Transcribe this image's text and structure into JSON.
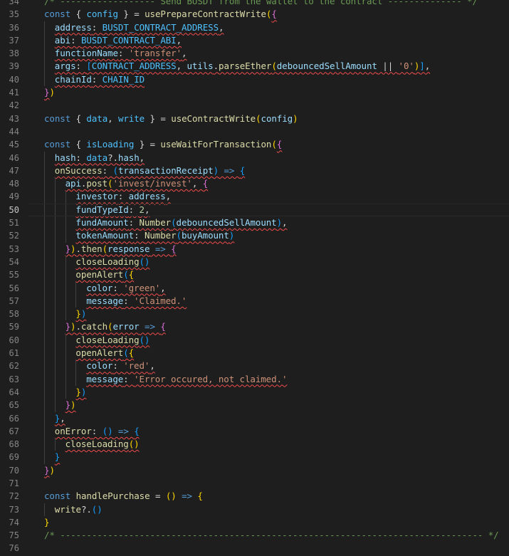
{
  "editor": {
    "language": "javascript",
    "current_line": 50,
    "colors": {
      "background": "#1e1e1e",
      "comment": "#6a9955",
      "keyword": "#569cd6",
      "function": "#dcdcaa",
      "string": "#ce9178",
      "number": "#b5cea8",
      "variable": "#9cdcfe",
      "constant": "#4fc1ff",
      "error_squiggle": "#f14c4c"
    },
    "lines": [
      {
        "n": "34",
        "indent": 1,
        "tokens": [
          {
            "t": "/* ------------------ Send BUSDT from the wallet to the contract -------------- */",
            "c": "cmt"
          }
        ]
      },
      {
        "n": "35",
        "indent": 1,
        "tokens": [
          {
            "t": "const",
            "c": "kw"
          },
          {
            "t": " { ",
            "c": "punct"
          },
          {
            "t": "config",
            "c": "const"
          },
          {
            "t": " } = ",
            "c": "punct"
          },
          {
            "t": "usePrepareContractWrite",
            "c": "fn"
          },
          {
            "t": "(",
            "c": "br1"
          },
          {
            "t": "{",
            "c": "br2",
            "s": true
          }
        ]
      },
      {
        "n": "36",
        "indent": 2,
        "tokens": [
          {
            "t": "address",
            "c": "plain",
            "s": true
          },
          {
            "t": ": ",
            "c": "punct",
            "s": true
          },
          {
            "t": "BUSDT_CONTRACT_ADDRESS",
            "c": "const",
            "s": true
          },
          {
            "t": ",",
            "c": "punct",
            "s": true
          }
        ]
      },
      {
        "n": "37",
        "indent": 2,
        "tokens": [
          {
            "t": "abi",
            "c": "plain",
            "s": true
          },
          {
            "t": ": ",
            "c": "punct",
            "s": true
          },
          {
            "t": "BUSDT_CONTRACT_ABI",
            "c": "const",
            "s": true
          },
          {
            "t": ",",
            "c": "punct",
            "s": true
          }
        ]
      },
      {
        "n": "38",
        "indent": 2,
        "tokens": [
          {
            "t": "functionName",
            "c": "plain",
            "s": true
          },
          {
            "t": ": ",
            "c": "punct",
            "s": true
          },
          {
            "t": "'transfer'",
            "c": "str",
            "s": true
          },
          {
            "t": ",",
            "c": "punct",
            "s": true
          }
        ]
      },
      {
        "n": "39",
        "indent": 2,
        "tokens": [
          {
            "t": "args",
            "c": "plain",
            "s": true
          },
          {
            "t": ": ",
            "c": "punct",
            "s": true
          },
          {
            "t": "[",
            "c": "br3",
            "s": true
          },
          {
            "t": "CONTRACT_ADDRESS",
            "c": "const",
            "s": true
          },
          {
            "t": ", ",
            "c": "punct",
            "s": true
          },
          {
            "t": "utils",
            "c": "plain",
            "s": true
          },
          {
            "t": ".",
            "c": "punct",
            "s": true
          },
          {
            "t": "parseEther",
            "c": "fn",
            "s": true
          },
          {
            "t": "(",
            "c": "br1",
            "s": true
          },
          {
            "t": "debouncedSellAmount",
            "c": "plain",
            "s": true
          },
          {
            "t": " || ",
            "c": "punct",
            "s": true
          },
          {
            "t": "'0'",
            "c": "str",
            "s": true
          },
          {
            "t": ")",
            "c": "br1",
            "s": true
          },
          {
            "t": "]",
            "c": "br3",
            "s": true
          },
          {
            "t": ",",
            "c": "punct",
            "s": true
          }
        ]
      },
      {
        "n": "40",
        "indent": 2,
        "tokens": [
          {
            "t": "chainId",
            "c": "plain",
            "s": true
          },
          {
            "t": ": ",
            "c": "punct",
            "s": true
          },
          {
            "t": "CHAIN_ID",
            "c": "const",
            "s": true
          }
        ]
      },
      {
        "n": "41",
        "indent": 1,
        "tokens": [
          {
            "t": "}",
            "c": "br2",
            "s": true
          },
          {
            "t": ")",
            "c": "br1"
          }
        ]
      },
      {
        "n": "42",
        "indent": 0,
        "tokens": []
      },
      {
        "n": "43",
        "indent": 1,
        "tokens": [
          {
            "t": "const",
            "c": "kw"
          },
          {
            "t": " { ",
            "c": "punct"
          },
          {
            "t": "data",
            "c": "const"
          },
          {
            "t": ", ",
            "c": "punct"
          },
          {
            "t": "write",
            "c": "const"
          },
          {
            "t": " } = ",
            "c": "punct"
          },
          {
            "t": "useContractWrite",
            "c": "fn"
          },
          {
            "t": "(",
            "c": "br1"
          },
          {
            "t": "config",
            "c": "plain"
          },
          {
            "t": ")",
            "c": "br1"
          }
        ]
      },
      {
        "n": "44",
        "indent": 0,
        "tokens": []
      },
      {
        "n": "45",
        "indent": 1,
        "tokens": [
          {
            "t": "const",
            "c": "kw"
          },
          {
            "t": " { ",
            "c": "punct"
          },
          {
            "t": "isLoading",
            "c": "const"
          },
          {
            "t": " } = ",
            "c": "punct"
          },
          {
            "t": "useWaitForTransaction",
            "c": "fn"
          },
          {
            "t": "(",
            "c": "br1"
          },
          {
            "t": "{",
            "c": "br2",
            "s": true
          }
        ]
      },
      {
        "n": "46",
        "indent": 2,
        "tokens": [
          {
            "t": "hash",
            "c": "plain",
            "s": true
          },
          {
            "t": ": ",
            "c": "punct",
            "s": true
          },
          {
            "t": "data",
            "c": "const",
            "s": true
          },
          {
            "t": "?.",
            "c": "punct",
            "s": true
          },
          {
            "t": "hash",
            "c": "plain",
            "s": true
          },
          {
            "t": ",",
            "c": "punct",
            "s": true
          }
        ]
      },
      {
        "n": "47",
        "indent": 2,
        "tokens": [
          {
            "t": "onSuccess",
            "c": "fn",
            "s": true
          },
          {
            "t": ": ",
            "c": "punct",
            "s": true
          },
          {
            "t": "(",
            "c": "br3",
            "s": true
          },
          {
            "t": "transactionReceipt",
            "c": "param",
            "s": true
          },
          {
            "t": ")",
            "c": "br3",
            "s": true
          },
          {
            "t": " => ",
            "c": "kw",
            "s": true
          },
          {
            "t": "{",
            "c": "br3",
            "s": true
          }
        ]
      },
      {
        "n": "48",
        "indent": 3,
        "tokens": [
          {
            "t": "api",
            "c": "plain",
            "s": true
          },
          {
            "t": ".",
            "c": "punct",
            "s": true
          },
          {
            "t": "post",
            "c": "fn",
            "s": true
          },
          {
            "t": "(",
            "c": "br1",
            "s": true
          },
          {
            "t": "'invest/invest'",
            "c": "str",
            "s": true
          },
          {
            "t": ", ",
            "c": "punct",
            "s": true
          },
          {
            "t": "{",
            "c": "br2",
            "s": true
          }
        ]
      },
      {
        "n": "49",
        "indent": 4,
        "tokens": [
          {
            "t": "investor",
            "c": "plain",
            "s": true
          },
          {
            "t": ": ",
            "c": "punct",
            "s": true
          },
          {
            "t": "address",
            "c": "plain",
            "s": true
          },
          {
            "t": ",",
            "c": "punct",
            "s": true
          }
        ]
      },
      {
        "n": "50",
        "indent": 4,
        "tokens": [
          {
            "t": "fundTypeId",
            "c": "plain",
            "s": true
          },
          {
            "t": ": ",
            "c": "punct",
            "s": true
          },
          {
            "t": "2",
            "c": "num",
            "s": true
          },
          {
            "t": ",",
            "c": "punct",
            "s": true
          }
        ]
      },
      {
        "n": "51",
        "indent": 4,
        "tokens": [
          {
            "t": "fundAmount",
            "c": "plain",
            "s": true
          },
          {
            "t": ": ",
            "c": "punct",
            "s": true
          },
          {
            "t": "Number",
            "c": "fn",
            "s": true
          },
          {
            "t": "(",
            "c": "br3",
            "s": true
          },
          {
            "t": "debouncedSellAmount",
            "c": "plain",
            "s": true
          },
          {
            "t": ")",
            "c": "br3",
            "s": true
          },
          {
            "t": ",",
            "c": "punct",
            "s": true
          }
        ]
      },
      {
        "n": "52",
        "indent": 4,
        "tokens": [
          {
            "t": "tokenAmount",
            "c": "plain",
            "s": true
          },
          {
            "t": ": ",
            "c": "punct",
            "s": true
          },
          {
            "t": "Number",
            "c": "fn",
            "s": true
          },
          {
            "t": "(",
            "c": "br3",
            "s": true
          },
          {
            "t": "buyAmount",
            "c": "plain",
            "s": true
          },
          {
            "t": ")",
            "c": "br3",
            "s": true
          }
        ]
      },
      {
        "n": "53",
        "indent": 3,
        "tokens": [
          {
            "t": "}",
            "c": "br2",
            "s": true
          },
          {
            "t": ")",
            "c": "br1",
            "s": true
          },
          {
            "t": ".",
            "c": "punct",
            "s": true
          },
          {
            "t": "then",
            "c": "fn",
            "s": true
          },
          {
            "t": "(",
            "c": "br1",
            "s": true
          },
          {
            "t": "response",
            "c": "param",
            "s": true
          },
          {
            "t": " => ",
            "c": "kw",
            "s": true
          },
          {
            "t": "{",
            "c": "br2",
            "s": true
          }
        ]
      },
      {
        "n": "54",
        "indent": 4,
        "tokens": [
          {
            "t": "closeLoading",
            "c": "fn",
            "s": true
          },
          {
            "t": "()",
            "c": "br3",
            "s": true
          }
        ]
      },
      {
        "n": "55",
        "indent": 4,
        "tokens": [
          {
            "t": "openAlert",
            "c": "fn",
            "s": true
          },
          {
            "t": "(",
            "c": "br3",
            "s": true
          },
          {
            "t": "{",
            "c": "br1",
            "s": true
          }
        ]
      },
      {
        "n": "56",
        "indent": 5,
        "tokens": [
          {
            "t": "color",
            "c": "plain",
            "s": true
          },
          {
            "t": ": ",
            "c": "punct",
            "s": true
          },
          {
            "t": "'green'",
            "c": "str",
            "s": true
          },
          {
            "t": ",",
            "c": "punct",
            "s": true
          }
        ]
      },
      {
        "n": "57",
        "indent": 5,
        "tokens": [
          {
            "t": "message",
            "c": "plain",
            "s": true
          },
          {
            "t": ": ",
            "c": "punct",
            "s": true
          },
          {
            "t": "'Claimed.'",
            "c": "str",
            "s": true
          }
        ]
      },
      {
        "n": "58",
        "indent": 4,
        "tokens": [
          {
            "t": "}",
            "c": "br1",
            "s": true
          },
          {
            "t": ")",
            "c": "br3",
            "s": true
          }
        ]
      },
      {
        "n": "59",
        "indent": 3,
        "tokens": [
          {
            "t": "}",
            "c": "br2",
            "s": true
          },
          {
            "t": ")",
            "c": "br1",
            "s": true
          },
          {
            "t": ".",
            "c": "punct",
            "s": true
          },
          {
            "t": "catch",
            "c": "fn",
            "s": true
          },
          {
            "t": "(",
            "c": "br1",
            "s": true
          },
          {
            "t": "error",
            "c": "param",
            "s": true
          },
          {
            "t": " => ",
            "c": "kw",
            "s": true
          },
          {
            "t": "{",
            "c": "br2",
            "s": true
          }
        ]
      },
      {
        "n": "60",
        "indent": 4,
        "tokens": [
          {
            "t": "closeLoading",
            "c": "fn",
            "s": true
          },
          {
            "t": "()",
            "c": "br3",
            "s": true
          }
        ]
      },
      {
        "n": "61",
        "indent": 4,
        "tokens": [
          {
            "t": "openAlert",
            "c": "fn",
            "s": true
          },
          {
            "t": "(",
            "c": "br3",
            "s": true
          },
          {
            "t": "{",
            "c": "br1",
            "s": true
          }
        ]
      },
      {
        "n": "62",
        "indent": 5,
        "tokens": [
          {
            "t": "color",
            "c": "plain",
            "s": true
          },
          {
            "t": ": ",
            "c": "punct",
            "s": true
          },
          {
            "t": "'red'",
            "c": "str",
            "s": true
          },
          {
            "t": ",",
            "c": "punct",
            "s": true
          }
        ]
      },
      {
        "n": "63",
        "indent": 5,
        "tokens": [
          {
            "t": "message",
            "c": "plain",
            "s": true
          },
          {
            "t": ": ",
            "c": "punct",
            "s": true
          },
          {
            "t": "'Error occured, not claimed.'",
            "c": "str",
            "s": true
          }
        ]
      },
      {
        "n": "64",
        "indent": 4,
        "tokens": [
          {
            "t": "}",
            "c": "br1",
            "s": true
          },
          {
            "t": ")",
            "c": "br3",
            "s": true
          }
        ]
      },
      {
        "n": "65",
        "indent": 3,
        "tokens": [
          {
            "t": "}",
            "c": "br2",
            "s": true
          },
          {
            "t": ")",
            "c": "br1",
            "s": true
          }
        ]
      },
      {
        "n": "66",
        "indent": 2,
        "tokens": [
          {
            "t": "}",
            "c": "br3",
            "s": true
          },
          {
            "t": ",",
            "c": "punct",
            "s": true
          }
        ]
      },
      {
        "n": "67",
        "indent": 2,
        "tokens": [
          {
            "t": "onError",
            "c": "fn",
            "s": true
          },
          {
            "t": ": ",
            "c": "punct",
            "s": true
          },
          {
            "t": "()",
            "c": "br3",
            "s": true
          },
          {
            "t": " => ",
            "c": "kw",
            "s": true
          },
          {
            "t": "{",
            "c": "br3",
            "s": true
          }
        ]
      },
      {
        "n": "68",
        "indent": 3,
        "tokens": [
          {
            "t": "closeLoading",
            "c": "fn",
            "s": true
          },
          {
            "t": "()",
            "c": "br1",
            "s": true
          }
        ]
      },
      {
        "n": "69",
        "indent": 2,
        "tokens": [
          {
            "t": "}",
            "c": "br3",
            "s": true
          }
        ]
      },
      {
        "n": "70",
        "indent": 1,
        "tokens": [
          {
            "t": "}",
            "c": "br2",
            "s": true
          },
          {
            "t": ")",
            "c": "br1"
          }
        ]
      },
      {
        "n": "71",
        "indent": 0,
        "tokens": []
      },
      {
        "n": "72",
        "indent": 1,
        "tokens": [
          {
            "t": "const",
            "c": "kw"
          },
          {
            "t": " ",
            "c": "punct"
          },
          {
            "t": "handlePurchase",
            "c": "fn"
          },
          {
            "t": " = ",
            "c": "punct"
          },
          {
            "t": "()",
            "c": "br1"
          },
          {
            "t": " => ",
            "c": "kw"
          },
          {
            "t": "{",
            "c": "br1"
          }
        ]
      },
      {
        "n": "73",
        "indent": 2,
        "tokens": [
          {
            "t": "write",
            "c": "fn"
          },
          {
            "t": "?.",
            "c": "punct"
          },
          {
            "t": "()",
            "c": "br3"
          }
        ]
      },
      {
        "n": "74",
        "indent": 1,
        "tokens": [
          {
            "t": "}",
            "c": "br1"
          }
        ]
      },
      {
        "n": "75",
        "indent": 1,
        "tokens": [
          {
            "t": "/* -------------------------------------------------------------------------------- */",
            "c": "cmt"
          }
        ]
      },
      {
        "n": "76",
        "indent": 0,
        "tokens": []
      }
    ]
  }
}
